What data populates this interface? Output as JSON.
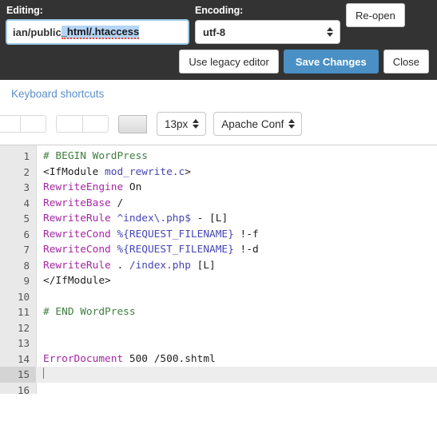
{
  "header": {
    "editing_label": "Editing:",
    "encoding_label": "Encoding:",
    "file_path_prefix": "ian/public",
    "file_path_selected": "_html/.htaccess",
    "encoding_value": "utf-8",
    "reopen_label": "Re-open",
    "legacy_label": "Use legacy editor",
    "save_label": "Save Changes",
    "close_label": "Close",
    "accent_color": "#4a90c4",
    "background_color": "#333333"
  },
  "toolbar": {
    "keyboard_shortcuts_label": "Keyboard shortcuts",
    "font_size_value": "13px",
    "syntax_mode_value": "Apache Conf",
    "link_color": "#5b8fc9"
  },
  "editor": {
    "active_line": 15,
    "total_lines": 16,
    "lines": [
      {
        "n": "1",
        "tokens": [
          {
            "t": "# BEGIN WordPress",
            "c": "tok-comment"
          }
        ]
      },
      {
        "n": "2",
        "tokens": [
          {
            "t": "<IfModule ",
            "c": "tok-tag"
          },
          {
            "t": "mod_rewrite.c",
            "c": "tok-arg"
          },
          {
            "t": ">",
            "c": "tok-tag"
          }
        ]
      },
      {
        "n": "3",
        "tokens": [
          {
            "t": "RewriteEngine ",
            "c": "tok-kw"
          },
          {
            "t": "On",
            "c": "tok-plain"
          }
        ]
      },
      {
        "n": "4",
        "tokens": [
          {
            "t": "RewriteBase ",
            "c": "tok-kw"
          },
          {
            "t": "/",
            "c": "tok-plain"
          }
        ]
      },
      {
        "n": "5",
        "tokens": [
          {
            "t": "RewriteRule ",
            "c": "tok-kw"
          },
          {
            "t": "^index\\.php$",
            "c": "tok-arg"
          },
          {
            "t": " - ",
            "c": "tok-plain"
          },
          {
            "t": "[L]",
            "c": "tok-plain"
          }
        ]
      },
      {
        "n": "6",
        "tokens": [
          {
            "t": "RewriteCond ",
            "c": "tok-kw"
          },
          {
            "t": "%{REQUEST_FILENAME}",
            "c": "tok-arg"
          },
          {
            "t": " !-f",
            "c": "tok-plain"
          }
        ]
      },
      {
        "n": "7",
        "tokens": [
          {
            "t": "RewriteCond ",
            "c": "tok-kw"
          },
          {
            "t": "%{REQUEST_FILENAME}",
            "c": "tok-arg"
          },
          {
            "t": " !-d",
            "c": "tok-plain"
          }
        ]
      },
      {
        "n": "8",
        "tokens": [
          {
            "t": "RewriteRule ",
            "c": "tok-kw"
          },
          {
            "t": ". ",
            "c": "tok-plain"
          },
          {
            "t": "/index.php",
            "c": "tok-arg"
          },
          {
            "t": " [L]",
            "c": "tok-plain"
          }
        ]
      },
      {
        "n": "9",
        "tokens": [
          {
            "t": "</IfModule>",
            "c": "tok-tag"
          }
        ]
      },
      {
        "n": "10",
        "tokens": []
      },
      {
        "n": "11",
        "tokens": [
          {
            "t": "# END WordPress",
            "c": "tok-comment"
          }
        ]
      },
      {
        "n": "12",
        "tokens": []
      },
      {
        "n": "13",
        "tokens": []
      },
      {
        "n": "14",
        "tokens": [
          {
            "t": "ErrorDocument ",
            "c": "tok-kw"
          },
          {
            "t": "500 ",
            "c": "tok-plain"
          },
          {
            "t": "/500.shtml",
            "c": "tok-plain"
          }
        ]
      },
      {
        "n": "15",
        "tokens": [],
        "active": true,
        "caret": true
      },
      {
        "n": "16",
        "tokens": []
      }
    ]
  }
}
